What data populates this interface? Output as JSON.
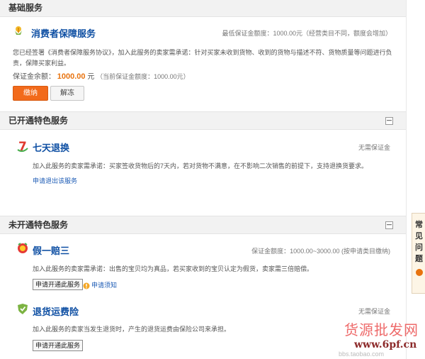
{
  "basic": {
    "header": "基础服务",
    "consumer": {
      "title": "消费者保障服务",
      "min_deposit": "最低保证金额度：1000.00元（经营类目不同，额度会增加）",
      "description": "您已经签署《消费者保障服务协议》，加入此服务的卖家需承诺：针对买家未收到货物、收到的货物与描述不符、货物质量等问题进行负责，保障买家利益。",
      "balance_label": "保证金余额：",
      "balance_value": "1000.00",
      "balance_unit": "元",
      "balance_note": "（当前保证金额度：1000.00元）",
      "pay_label": "缴纳",
      "release_label": "解冻"
    }
  },
  "opened": {
    "header": "已开通特色服务",
    "collapse": "－",
    "seven_day": {
      "icon_text": "7",
      "title": "七天退换",
      "deposit": "无需保证金",
      "description": "加入此服务的卖家需承诺：买家签收货物后的7天内，若对货物不满意，在不影响二次销售的前提下，支持退换货要求。",
      "exit_link": "申请退出该服务"
    }
  },
  "unopened": {
    "header": "未开通特色服务",
    "collapse": "－",
    "fake_pay": {
      "title": "假一赔三",
      "deposit": "保证金额度：1000.00~3000.00 (按申请类目缴纳)",
      "description": "加入此服务的卖家需承诺：出售的宝贝均为真品，若买家收到的宝贝认定为假货，卖家需三倍赔偿。",
      "apply_label": "申请开通此服务",
      "notice_link": "申请须知"
    },
    "return_insurance": {
      "title": "退货运费险",
      "deposit": "无需保证金",
      "description": "加入此服务的卖家当发生退货时，产生的退货运费由保险公司来承担。",
      "apply_label": "申请开通此服务"
    }
  },
  "sidebar": {
    "faq_chars": [
      "常",
      "见",
      "问",
      "题"
    ]
  },
  "watermark": {
    "line1": "货源批发网",
    "line2": "www.6pf.cn",
    "line3": "bbs.taobao.com"
  }
}
